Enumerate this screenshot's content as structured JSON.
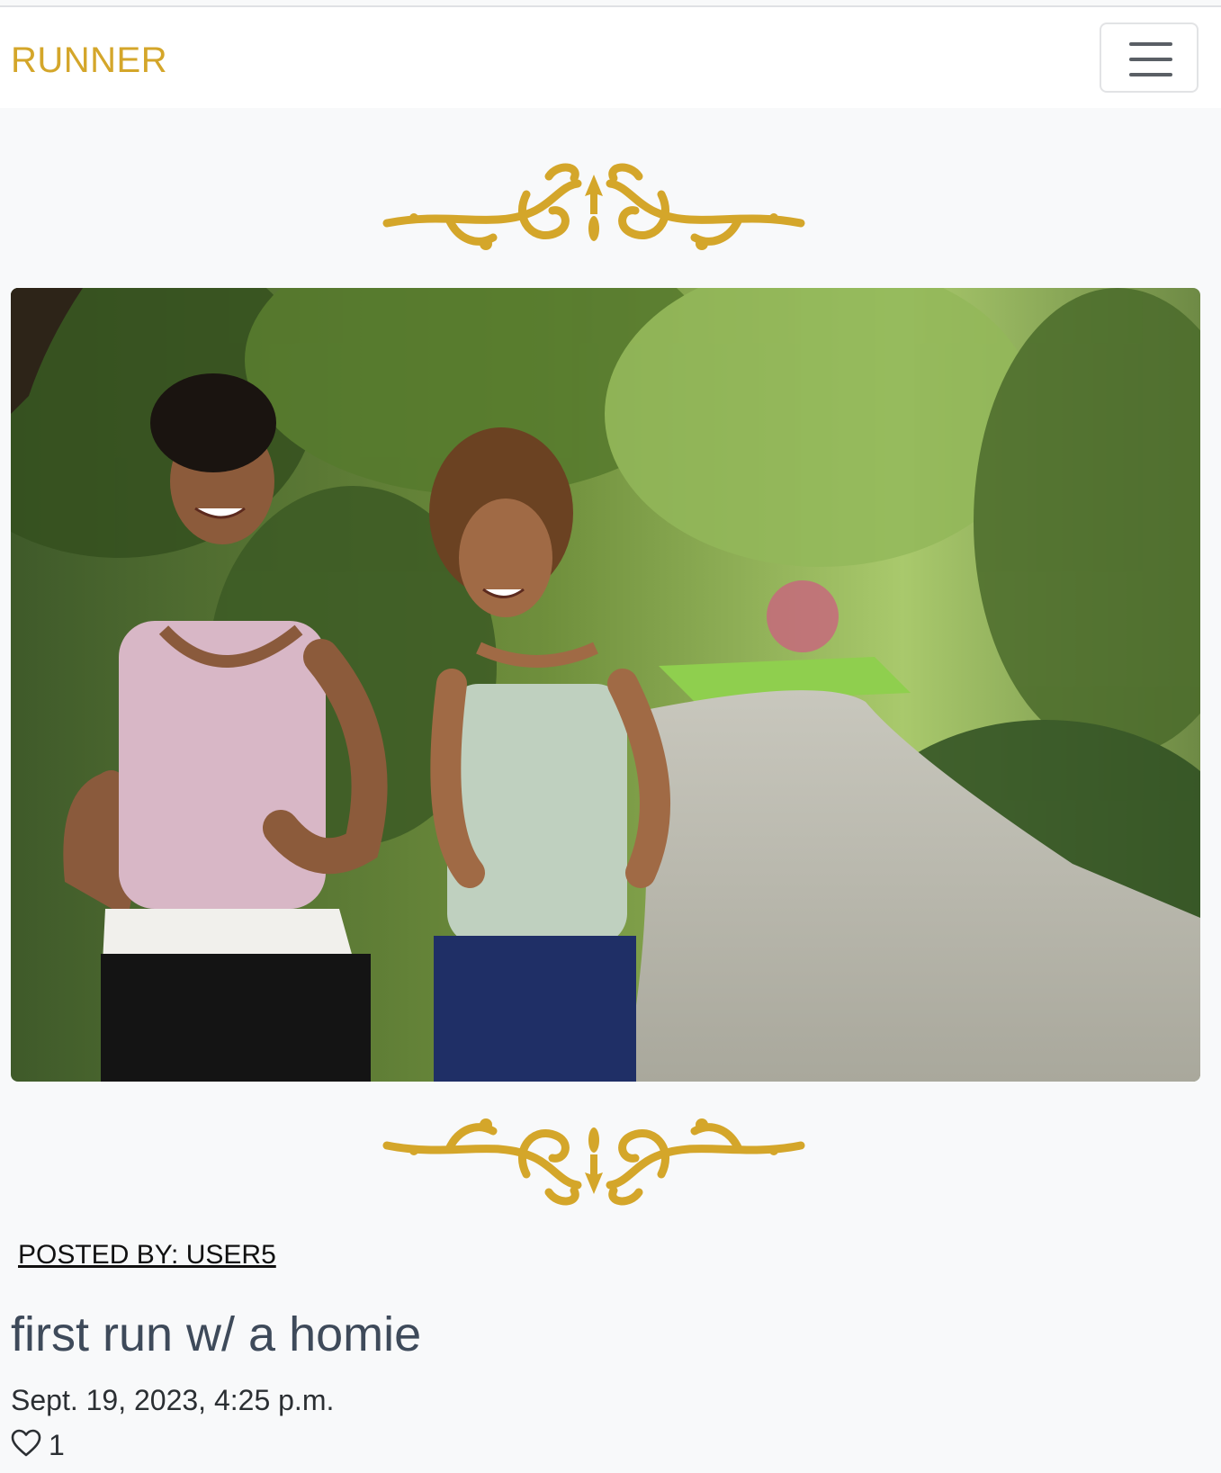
{
  "navbar": {
    "brand": "RUNNER",
    "toggle_icon": "hamburger-menu-icon"
  },
  "post": {
    "author_line": "POSTED BY: USER5",
    "title": "first run w/ a homie",
    "date": "Sept. 19, 2023, 4:25 p.m.",
    "like_icon": "heart-icon",
    "likes": "1",
    "image_description": "Two women laughing while jogging on a tree-lined park path"
  },
  "colors": {
    "brand": "#d4a62a",
    "ornament": "#d4a62a",
    "page_bg": "#f8f9fa"
  }
}
